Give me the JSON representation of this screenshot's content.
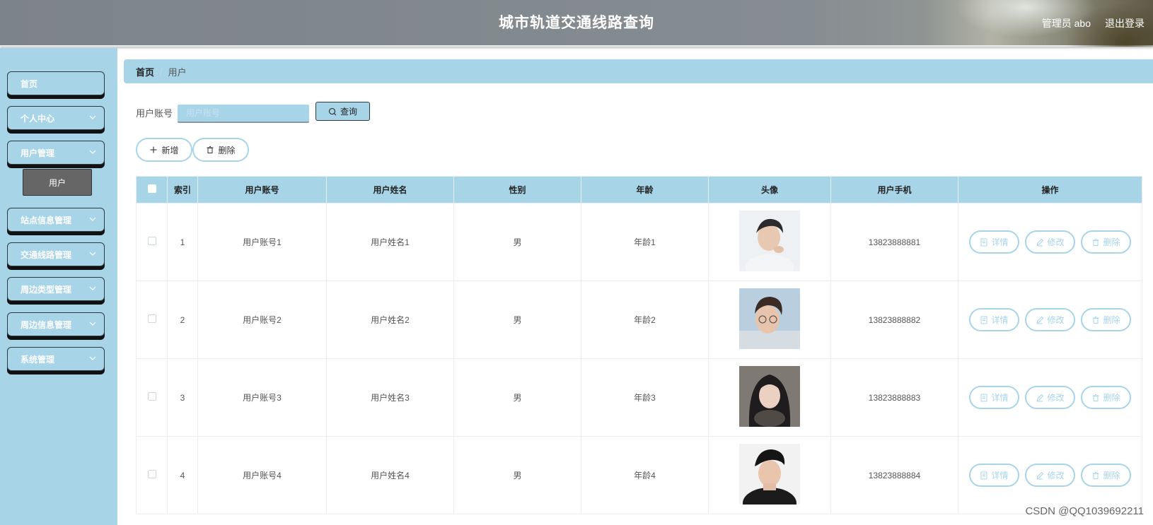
{
  "app": {
    "title": "城市轨道交通线路查询"
  },
  "header": {
    "admin_label": "管理员 abo",
    "logout_label": "退出登录"
  },
  "sidebar": {
    "items": [
      {
        "label": "首页",
        "has_children": false
      },
      {
        "label": "个人中心",
        "has_children": true
      },
      {
        "label": "用户管理",
        "has_children": true,
        "expanded": true
      },
      {
        "label": "站点信息管理",
        "has_children": true
      },
      {
        "label": "交通线路管理",
        "has_children": true
      },
      {
        "label": "周边类型管理",
        "has_children": true
      },
      {
        "label": "周边信息管理",
        "has_children": true
      },
      {
        "label": "系统管理",
        "has_children": true
      }
    ],
    "submenu": {
      "label": "用户"
    }
  },
  "breadcrumb": {
    "home": "首页",
    "separator": "/",
    "current": "用户"
  },
  "search": {
    "label": "用户账号",
    "placeholder": "用户账号",
    "value": "",
    "button_label": "查询"
  },
  "toolbar": {
    "add_label": "新增",
    "delete_label": "删除"
  },
  "table": {
    "columns": [
      "索引",
      "用户账号",
      "用户姓名",
      "性别",
      "年龄",
      "头像",
      "用户手机",
      "操作"
    ],
    "rows": [
      {
        "index": "1",
        "account": "用户账号1",
        "name": "用户姓名1",
        "gender": "男",
        "age": "年龄1",
        "phone": "13823888881"
      },
      {
        "index": "2",
        "account": "用户账号2",
        "name": "用户姓名2",
        "gender": "男",
        "age": "年龄2",
        "phone": "13823888882"
      },
      {
        "index": "3",
        "account": "用户账号3",
        "name": "用户姓名3",
        "gender": "男",
        "age": "年龄3",
        "phone": "13823888883"
      },
      {
        "index": "4",
        "account": "用户账号4",
        "name": "用户姓名4",
        "gender": "男",
        "age": "年龄4",
        "phone": "13823888884"
      }
    ],
    "actions": {
      "detail": "详情",
      "edit": "修改",
      "delete": "删除"
    }
  },
  "colors": {
    "accent": "#a8d4e8",
    "header_bg": "#7d8489",
    "submenu_bg": "#666666"
  },
  "watermark": "CSDN @QQ1039692211"
}
